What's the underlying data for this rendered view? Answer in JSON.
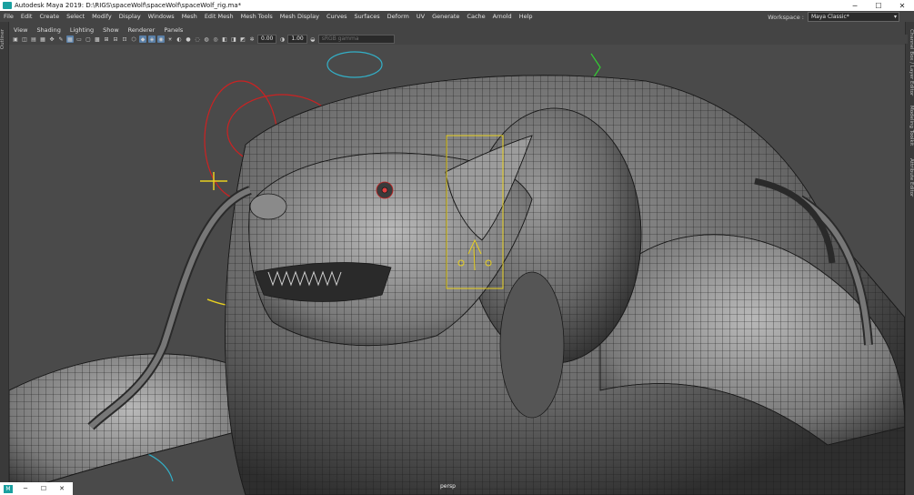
{
  "window": {
    "title": "Autodesk Maya 2019: D:\\RIGS\\spaceWolf\\spaceWolf\\spaceWolf_rig.ma*",
    "min_icon": "─",
    "max_icon": "☐",
    "close_icon": "✕"
  },
  "menubar": {
    "items": [
      "File",
      "Edit",
      "Create",
      "Select",
      "Modify",
      "Display",
      "Windows",
      "Mesh",
      "Edit Mesh",
      "Mesh Tools",
      "Mesh Display",
      "Curves",
      "Surfaces",
      "Deform",
      "UV",
      "Generate",
      "Cache",
      "Arnold",
      "Help"
    ]
  },
  "workspace": {
    "label": "Workspace :",
    "value": "Maya Classic*"
  },
  "panel_menu": {
    "items": [
      "View",
      "Shading",
      "Lighting",
      "Show",
      "Renderer",
      "Panels"
    ]
  },
  "toolbar": {
    "value1": "0.00",
    "value2": "1.00",
    "color_space": "sRGB gamma"
  },
  "side_tabs": {
    "left": "Outliner",
    "right": [
      "Channel Box / Layer Editor",
      "Modeling Toolkit",
      "Attribute Editor"
    ]
  },
  "viewport": {
    "camera": "persp"
  },
  "taskbar": {
    "logo": "M",
    "min_icon": "─",
    "max_icon": "☐",
    "close_icon": "✕"
  },
  "colors": {
    "accent": "#5a7fa6",
    "wire_red": "#cc2222",
    "wire_green": "#33cc33",
    "wire_cyan": "#33b0c8",
    "wire_yellow": "#e8d020"
  }
}
